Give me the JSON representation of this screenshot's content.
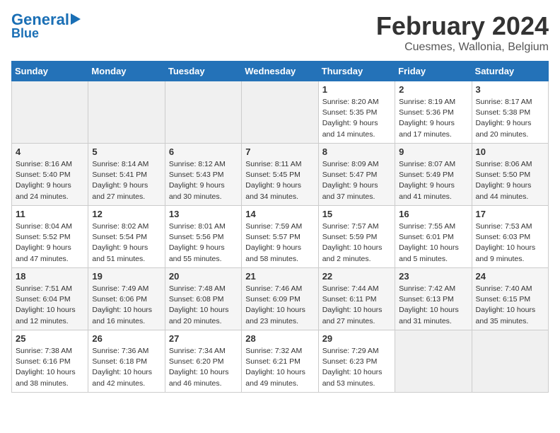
{
  "logo": {
    "line1": "General",
    "line2": "Blue"
  },
  "title": "February 2024",
  "subtitle": "Cuesmes, Wallonia, Belgium",
  "days_of_week": [
    "Sunday",
    "Monday",
    "Tuesday",
    "Wednesday",
    "Thursday",
    "Friday",
    "Saturday"
  ],
  "weeks": [
    [
      {
        "day": "",
        "content": ""
      },
      {
        "day": "",
        "content": ""
      },
      {
        "day": "",
        "content": ""
      },
      {
        "day": "",
        "content": ""
      },
      {
        "day": "1",
        "content": "Sunrise: 8:20 AM\nSunset: 5:35 PM\nDaylight: 9 hours\nand 14 minutes."
      },
      {
        "day": "2",
        "content": "Sunrise: 8:19 AM\nSunset: 5:36 PM\nDaylight: 9 hours\nand 17 minutes."
      },
      {
        "day": "3",
        "content": "Sunrise: 8:17 AM\nSunset: 5:38 PM\nDaylight: 9 hours\nand 20 minutes."
      }
    ],
    [
      {
        "day": "4",
        "content": "Sunrise: 8:16 AM\nSunset: 5:40 PM\nDaylight: 9 hours\nand 24 minutes."
      },
      {
        "day": "5",
        "content": "Sunrise: 8:14 AM\nSunset: 5:41 PM\nDaylight: 9 hours\nand 27 minutes."
      },
      {
        "day": "6",
        "content": "Sunrise: 8:12 AM\nSunset: 5:43 PM\nDaylight: 9 hours\nand 30 minutes."
      },
      {
        "day": "7",
        "content": "Sunrise: 8:11 AM\nSunset: 5:45 PM\nDaylight: 9 hours\nand 34 minutes."
      },
      {
        "day": "8",
        "content": "Sunrise: 8:09 AM\nSunset: 5:47 PM\nDaylight: 9 hours\nand 37 minutes."
      },
      {
        "day": "9",
        "content": "Sunrise: 8:07 AM\nSunset: 5:49 PM\nDaylight: 9 hours\nand 41 minutes."
      },
      {
        "day": "10",
        "content": "Sunrise: 8:06 AM\nSunset: 5:50 PM\nDaylight: 9 hours\nand 44 minutes."
      }
    ],
    [
      {
        "day": "11",
        "content": "Sunrise: 8:04 AM\nSunset: 5:52 PM\nDaylight: 9 hours\nand 47 minutes."
      },
      {
        "day": "12",
        "content": "Sunrise: 8:02 AM\nSunset: 5:54 PM\nDaylight: 9 hours\nand 51 minutes."
      },
      {
        "day": "13",
        "content": "Sunrise: 8:01 AM\nSunset: 5:56 PM\nDaylight: 9 hours\nand 55 minutes."
      },
      {
        "day": "14",
        "content": "Sunrise: 7:59 AM\nSunset: 5:57 PM\nDaylight: 9 hours\nand 58 minutes."
      },
      {
        "day": "15",
        "content": "Sunrise: 7:57 AM\nSunset: 5:59 PM\nDaylight: 10 hours\nand 2 minutes."
      },
      {
        "day": "16",
        "content": "Sunrise: 7:55 AM\nSunset: 6:01 PM\nDaylight: 10 hours\nand 5 minutes."
      },
      {
        "day": "17",
        "content": "Sunrise: 7:53 AM\nSunset: 6:03 PM\nDaylight: 10 hours\nand 9 minutes."
      }
    ],
    [
      {
        "day": "18",
        "content": "Sunrise: 7:51 AM\nSunset: 6:04 PM\nDaylight: 10 hours\nand 12 minutes."
      },
      {
        "day": "19",
        "content": "Sunrise: 7:49 AM\nSunset: 6:06 PM\nDaylight: 10 hours\nand 16 minutes."
      },
      {
        "day": "20",
        "content": "Sunrise: 7:48 AM\nSunset: 6:08 PM\nDaylight: 10 hours\nand 20 minutes."
      },
      {
        "day": "21",
        "content": "Sunrise: 7:46 AM\nSunset: 6:09 PM\nDaylight: 10 hours\nand 23 minutes."
      },
      {
        "day": "22",
        "content": "Sunrise: 7:44 AM\nSunset: 6:11 PM\nDaylight: 10 hours\nand 27 minutes."
      },
      {
        "day": "23",
        "content": "Sunrise: 7:42 AM\nSunset: 6:13 PM\nDaylight: 10 hours\nand 31 minutes."
      },
      {
        "day": "24",
        "content": "Sunrise: 7:40 AM\nSunset: 6:15 PM\nDaylight: 10 hours\nand 35 minutes."
      }
    ],
    [
      {
        "day": "25",
        "content": "Sunrise: 7:38 AM\nSunset: 6:16 PM\nDaylight: 10 hours\nand 38 minutes."
      },
      {
        "day": "26",
        "content": "Sunrise: 7:36 AM\nSunset: 6:18 PM\nDaylight: 10 hours\nand 42 minutes."
      },
      {
        "day": "27",
        "content": "Sunrise: 7:34 AM\nSunset: 6:20 PM\nDaylight: 10 hours\nand 46 minutes."
      },
      {
        "day": "28",
        "content": "Sunrise: 7:32 AM\nSunset: 6:21 PM\nDaylight: 10 hours\nand 49 minutes."
      },
      {
        "day": "29",
        "content": "Sunrise: 7:29 AM\nSunset: 6:23 PM\nDaylight: 10 hours\nand 53 minutes."
      },
      {
        "day": "",
        "content": ""
      },
      {
        "day": "",
        "content": ""
      }
    ]
  ]
}
